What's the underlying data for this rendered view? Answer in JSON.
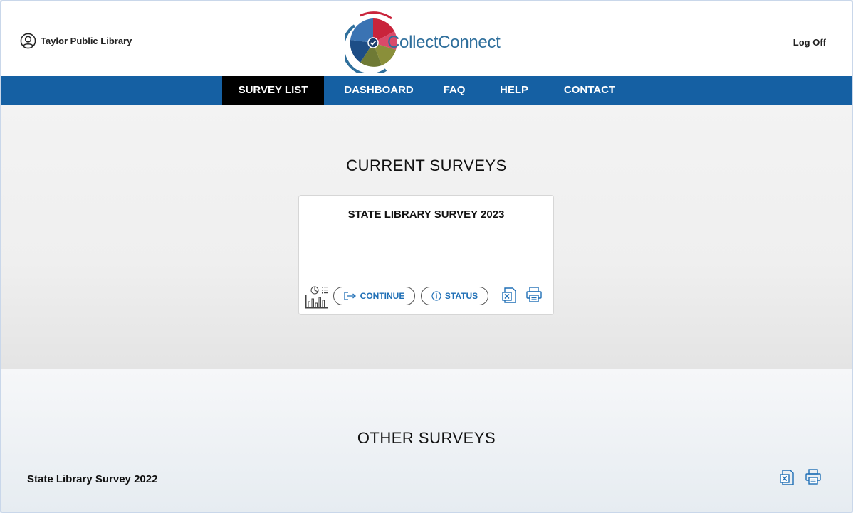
{
  "header": {
    "organization": "Taylor Public Library",
    "logo_text": "CollectConnect",
    "logoff_label": "Log Off"
  },
  "nav": {
    "items": [
      {
        "label": "SURVEY LIST",
        "active": true
      },
      {
        "label": "DASHBOARD",
        "active": false
      },
      {
        "label": "FAQ",
        "active": false
      },
      {
        "label": "HELP",
        "active": false
      },
      {
        "label": "CONTACT",
        "active": false
      }
    ]
  },
  "current": {
    "title": "CURRENT SURVEYS",
    "card": {
      "title": "STATE LIBRARY SURVEY 2023",
      "continue_label": "CONTINUE",
      "status_label": "STATUS"
    }
  },
  "other": {
    "title": "OTHER SURVEYS",
    "rows": [
      {
        "label": "State Library Survey 2022"
      }
    ]
  },
  "icons": {
    "user": "user-circle-icon",
    "chart": "chart-icon",
    "continue": "arrow-right-icon",
    "status": "info-icon",
    "excel": "excel-icon",
    "print": "printer-icon"
  },
  "colors": {
    "nav_bg": "#1560a3",
    "nav_active": "#000000",
    "accent": "#1f6fb6"
  }
}
